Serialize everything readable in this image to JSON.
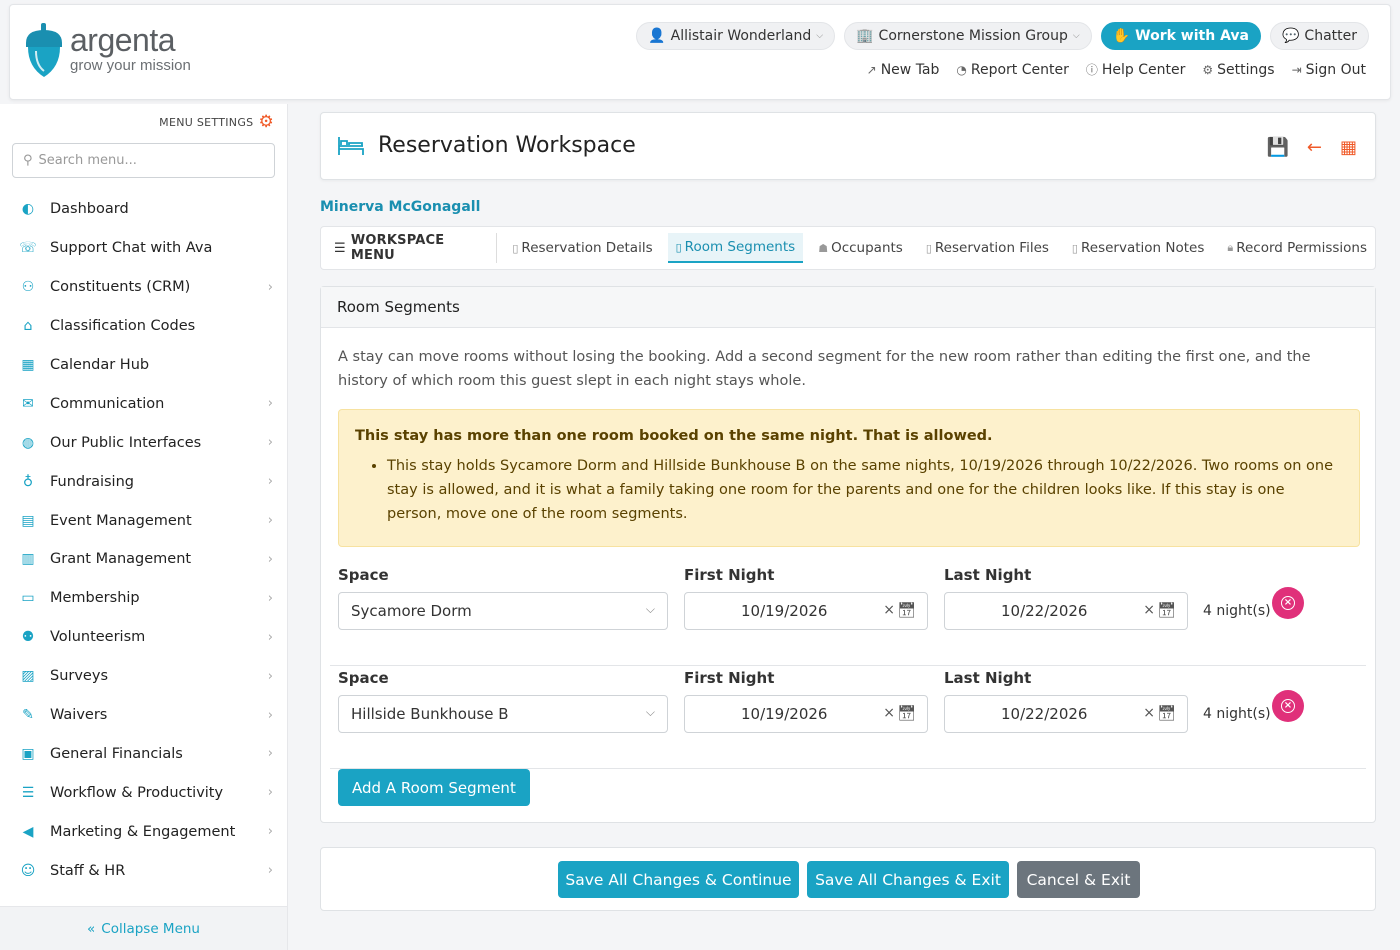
{
  "brand": {
    "name": "argenta",
    "tagline": "grow your mission",
    "accent": "#1aa3c4",
    "orange": "#f05a28",
    "danger": "#e0307a"
  },
  "header": {
    "user": "Allistair Wonderland",
    "org": "Cornerstone Mission Group",
    "ava": "Work with Ava",
    "chatter": "Chatter",
    "links": {
      "new_tab": "New Tab",
      "report": "Report Center",
      "help": "Help Center",
      "settings": "Settings",
      "signout": "Sign Out"
    }
  },
  "sidebar": {
    "menu_settings": "MENU SETTINGS",
    "search_placeholder": "Search menu...",
    "items": [
      {
        "label": "Dashboard",
        "icon": "dashboard-icon",
        "sub": false
      },
      {
        "label": "Support Chat with Ava",
        "icon": "chat-icon",
        "sub": false
      },
      {
        "label": "Constituents (CRM)",
        "icon": "people-icon",
        "sub": true
      },
      {
        "label": "Classification Codes",
        "icon": "tag-icon",
        "sub": false
      },
      {
        "label": "Calendar Hub",
        "icon": "calendar-icon",
        "sub": false
      },
      {
        "label": "Communication",
        "icon": "mail-icon",
        "sub": true
      },
      {
        "label": "Our Public Interfaces",
        "icon": "globe-icon",
        "sub": true
      },
      {
        "label": "Fundraising",
        "icon": "donate-icon",
        "sub": true
      },
      {
        "label": "Event Management",
        "icon": "event-icon",
        "sub": true
      },
      {
        "label": "Grant Management",
        "icon": "grant-icon",
        "sub": true
      },
      {
        "label": "Membership",
        "icon": "card-icon",
        "sub": true
      },
      {
        "label": "Volunteerism",
        "icon": "volunteer-icon",
        "sub": true
      },
      {
        "label": "Surveys",
        "icon": "survey-icon",
        "sub": true
      },
      {
        "label": "Waivers",
        "icon": "waiver-icon",
        "sub": true
      },
      {
        "label": "General Financials",
        "icon": "finance-icon",
        "sub": true
      },
      {
        "label": "Workflow & Productivity",
        "icon": "workflow-icon",
        "sub": true
      },
      {
        "label": "Marketing & Engagement",
        "icon": "megaphone-icon",
        "sub": true
      },
      {
        "label": "Staff & HR",
        "icon": "staff-icon",
        "sub": true
      }
    ],
    "collapse": "Collapse Menu"
  },
  "workspace": {
    "title": "Reservation Workspace",
    "person": "Minerva McGonagall",
    "menu_label": "WORKSPACE MENU",
    "tabs": [
      "Reservation Details",
      "Room Segments",
      "Occupants",
      "Reservation Files",
      "Reservation Notes",
      "Record Permissions"
    ]
  },
  "panel": {
    "title": "Room Segments",
    "intro": "A stay can move rooms without losing the booking. Add a second segment for the new room rather than editing the first one, and the history of which room this guest slept in each night stays whole.",
    "warning_title": "This stay has more than one room booked on the same night. That is allowed.",
    "warning_item": "This stay holds Sycamore Dorm and Hillside Bunkhouse B on the same nights, 10/19/2026 through 10/22/2026. Two rooms on one stay is allowed, and it is what a family taking one room for the parents and one for the children looks like. If this stay is one person, move one of the room segments.",
    "labels": {
      "space": "Space",
      "first": "First Night",
      "last": "Last Night"
    },
    "segments": [
      {
        "space": "Sycamore Dorm",
        "first": "10/19/2026",
        "last": "10/22/2026",
        "nights": "4 night(s)"
      },
      {
        "space": "Hillside Bunkhouse B",
        "first": "10/19/2026",
        "last": "10/22/2026",
        "nights": "4 night(s)"
      }
    ],
    "add": "Add A Room Segment"
  },
  "footer": {
    "save_continue": "Save All Changes & Continue",
    "save_exit": "Save All Changes & Exit",
    "cancel": "Cancel & Exit"
  }
}
